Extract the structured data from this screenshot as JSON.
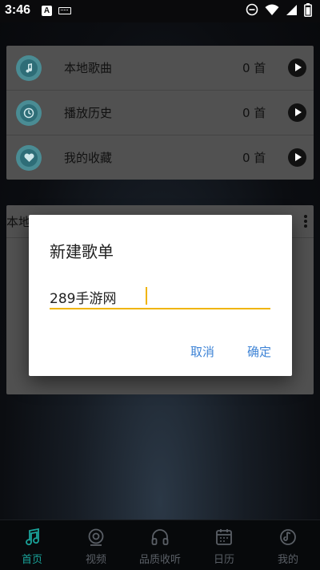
{
  "status_bar": {
    "time": "3:46",
    "notif_letter": "A",
    "icons": [
      "keyboard-icon",
      "dnd-icon",
      "wifi-icon",
      "signal-icon",
      "battery-icon"
    ]
  },
  "quick_list": {
    "items": [
      {
        "label": "本地歌曲",
        "count": "0 首",
        "icon": "music-note-icon"
      },
      {
        "label": "播放历史",
        "count": "0 首",
        "icon": "clock-icon"
      },
      {
        "label": "我的收藏",
        "count": "0 首",
        "icon": "heart-icon"
      }
    ]
  },
  "playlist_card": {
    "title_partial": "本地"
  },
  "dialog": {
    "title": "新建歌单",
    "input_value": "289手游网",
    "cancel_label": "取消",
    "ok_label": "确定",
    "accent_color": "#f0b400",
    "button_color": "#3f84d6"
  },
  "bottom_nav": {
    "items": [
      {
        "label": "首页",
        "icon": "music-icon",
        "active": true
      },
      {
        "label": "视频",
        "icon": "video-icon",
        "active": false
      },
      {
        "label": "品质收听",
        "icon": "headphones-icon",
        "active": false
      },
      {
        "label": "日历",
        "icon": "calendar-icon",
        "active": false
      },
      {
        "label": "我的",
        "icon": "profile-icon",
        "active": false
      }
    ],
    "active_color": "#1aa39a"
  }
}
